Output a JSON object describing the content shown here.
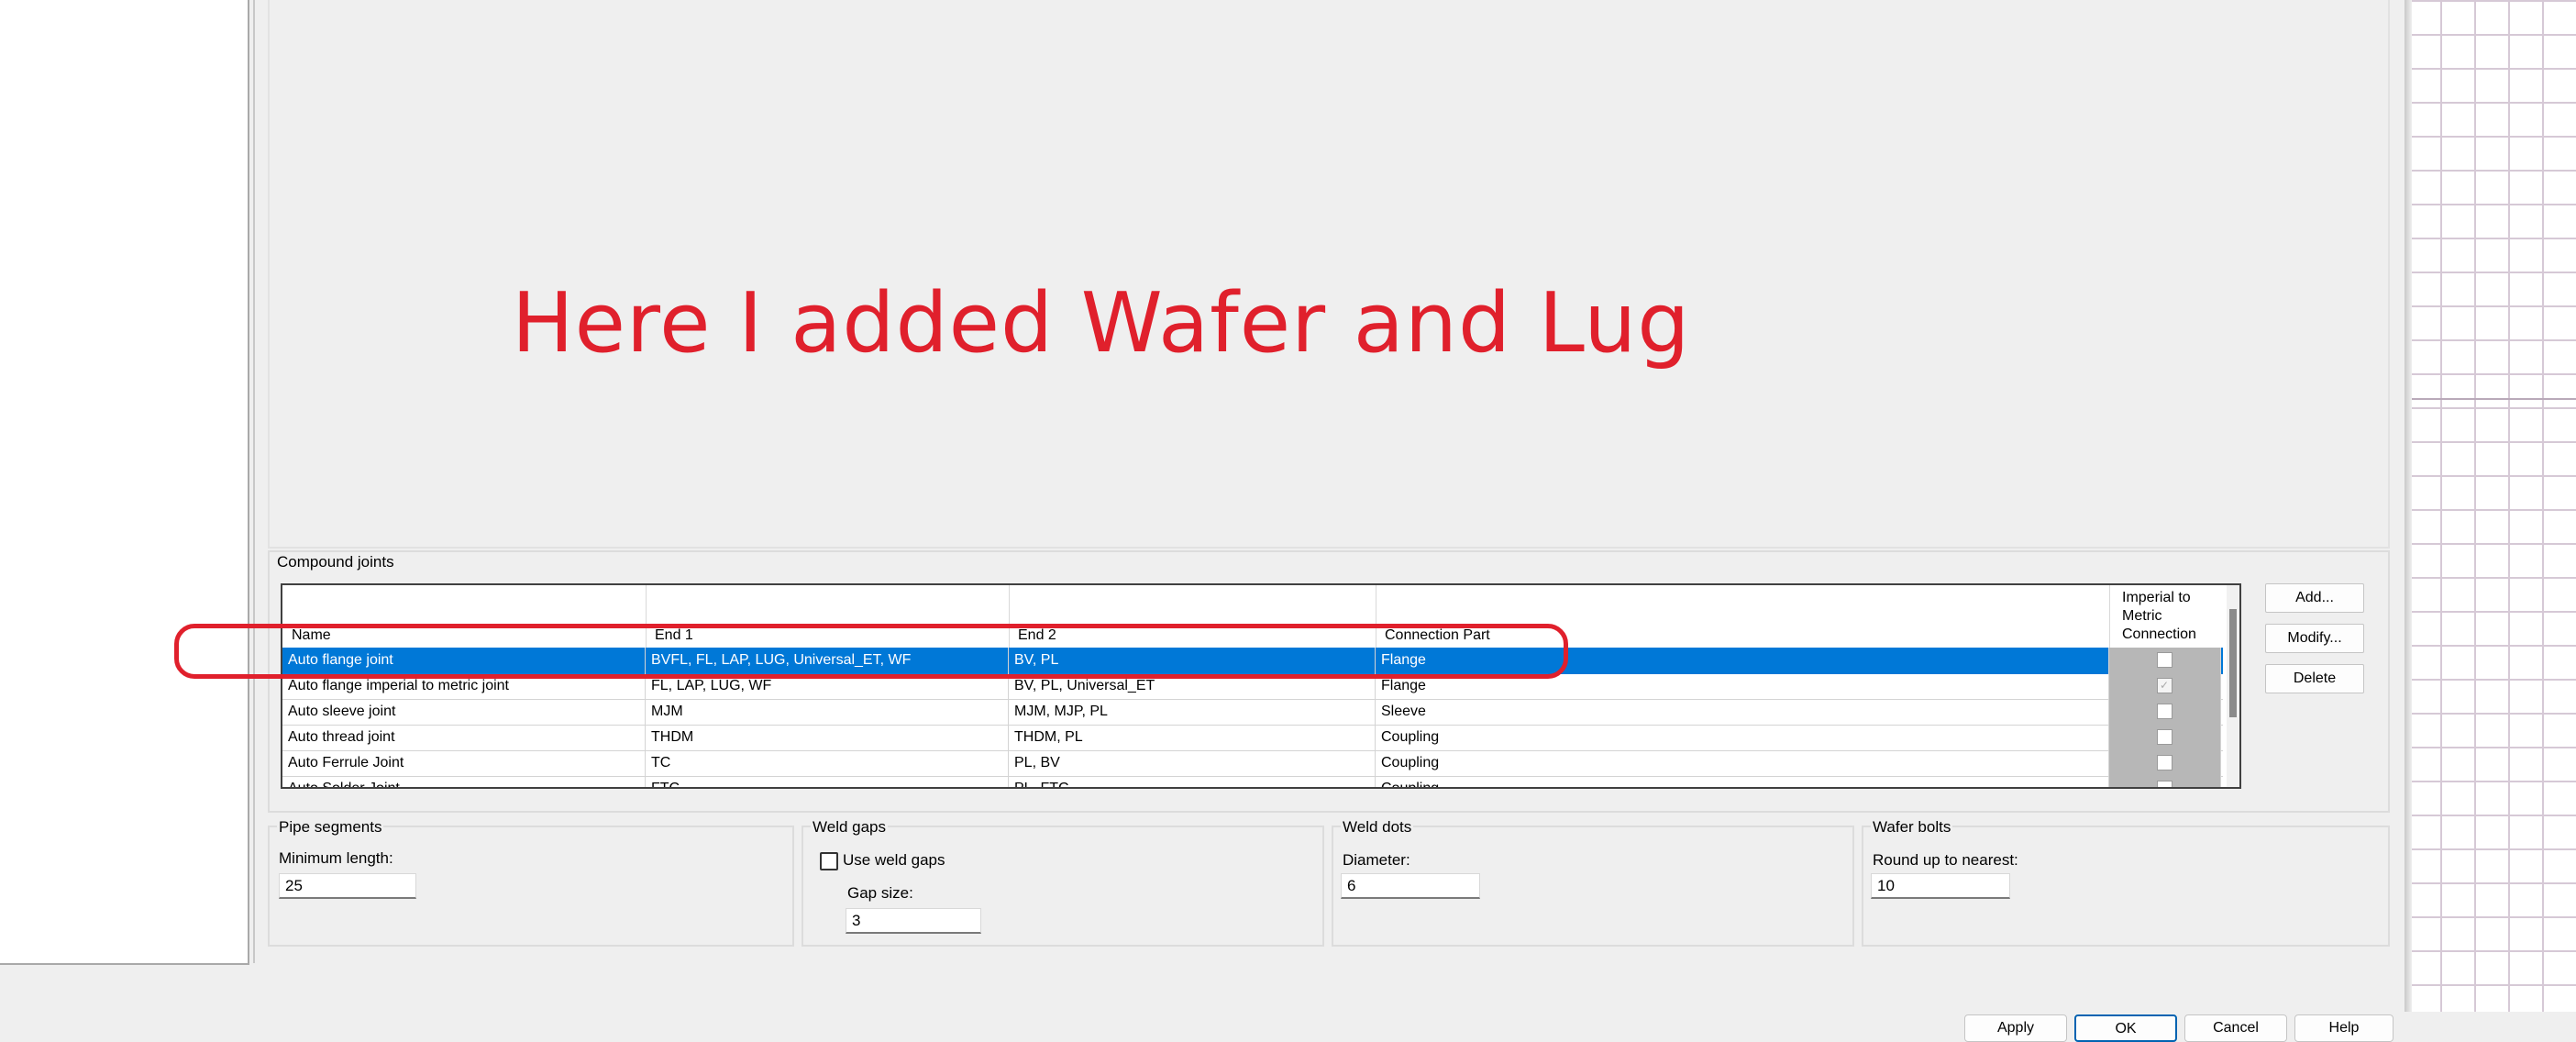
{
  "annotation": {
    "text": "Here I added Wafer and Lug",
    "color": "#e0202c"
  },
  "compound_joints": {
    "title": "Compound joints",
    "columns": {
      "name": "Name",
      "end1": "End 1",
      "end2": "End 2",
      "connection_part": "Connection Part",
      "imperial": "Imperial to\nMetric\nConnection"
    },
    "rows": [
      {
        "name": "Auto flange joint",
        "end1": "BVFL, FL, LAP, LUG, Universal_ET, WF",
        "end2": "BV, PL",
        "part": "Flange",
        "imperial_checked": false,
        "selected": true
      },
      {
        "name": "Auto flange imperial to metric joint",
        "end1": "FL, LAP, LUG, WF",
        "end2": "BV, PL, Universal_ET",
        "part": "Flange",
        "imperial_checked": true,
        "selected": false
      },
      {
        "name": "Auto sleeve joint",
        "end1": "MJM",
        "end2": "MJM, MJP, PL",
        "part": "Sleeve",
        "imperial_checked": false,
        "selected": false
      },
      {
        "name": "Auto thread joint",
        "end1": "THDM",
        "end2": "THDM, PL",
        "part": "Coupling",
        "imperial_checked": false,
        "selected": false
      },
      {
        "name": "Auto Ferrule Joint",
        "end1": "TC",
        "end2": "PL, BV",
        "part": "Coupling",
        "imperial_checked": false,
        "selected": false
      },
      {
        "name": "Auto Solder Joint",
        "end1": "FTC",
        "end2": "PL, FTC",
        "part": "Coupling",
        "imperial_checked": false,
        "selected": false
      }
    ],
    "buttons": {
      "add": "Add...",
      "modify": "Modify...",
      "delete": "Delete"
    }
  },
  "pipe_segments": {
    "title": "Pipe segments",
    "min_length_label": "Minimum length:",
    "min_length_value": "25"
  },
  "weld_gaps": {
    "title": "Weld gaps",
    "use_label": "Use weld gaps",
    "use_checked": false,
    "gap_size_label": "Gap size:",
    "gap_size_value": "3"
  },
  "weld_dots": {
    "title": "Weld dots",
    "diameter_label": "Diameter:",
    "diameter_value": "6"
  },
  "wafer_bolts": {
    "title": "Wafer bolts",
    "round_label": "Round up to nearest:",
    "round_value": "10"
  },
  "dialog_buttons": {
    "apply": "Apply",
    "ok": "OK",
    "cancel": "Cancel",
    "help": "Help"
  },
  "colors": {
    "selection": "#0078d7",
    "annotation": "#e0202c"
  }
}
